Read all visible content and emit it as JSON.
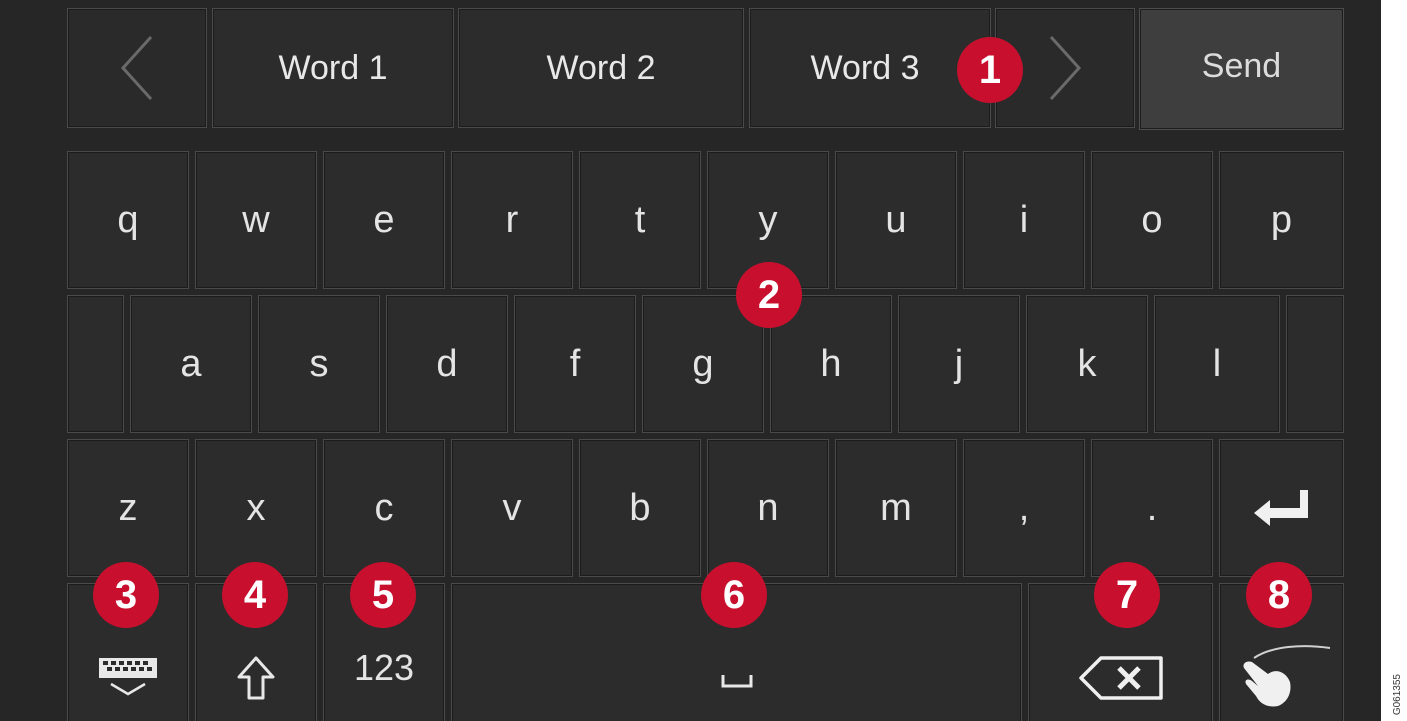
{
  "suggestion_bar": {
    "prev_icon": "chevron-left-icon",
    "words": [
      "Word 1",
      "Word 2",
      "Word 3"
    ],
    "next_icon": "chevron-right-icon",
    "send_label": "Send"
  },
  "keyboard": {
    "row1": [
      "q",
      "w",
      "e",
      "r",
      "t",
      "y",
      "u",
      "i",
      "o",
      "p"
    ],
    "row2": [
      "a",
      "s",
      "d",
      "f",
      "g",
      "h",
      "j",
      "k",
      "l"
    ],
    "row3": [
      "z",
      "x",
      "c",
      "v",
      "b",
      "n",
      "m",
      ",",
      "."
    ],
    "enter_icon": "enter-arrow-icon",
    "bottom_row": {
      "hide_keyboard_icon": "keyboard-hide-icon",
      "shift_icon": "shift-arrow-icon",
      "numbers_label": "123",
      "space_icon": "space-bar-icon",
      "backspace_icon": "backspace-icon",
      "handwriting_icon": "handwriting-hand-icon"
    }
  },
  "callouts": [
    "1",
    "2",
    "3",
    "4",
    "5",
    "6",
    "7",
    "8"
  ],
  "colors": {
    "screen_bg": "#262626",
    "key_bg": "#2c2c2c",
    "send_bg": "#3e3e3e",
    "callout_red": "#c8102e",
    "key_text": "#e4e4e4"
  },
  "figure_code": "G061355"
}
